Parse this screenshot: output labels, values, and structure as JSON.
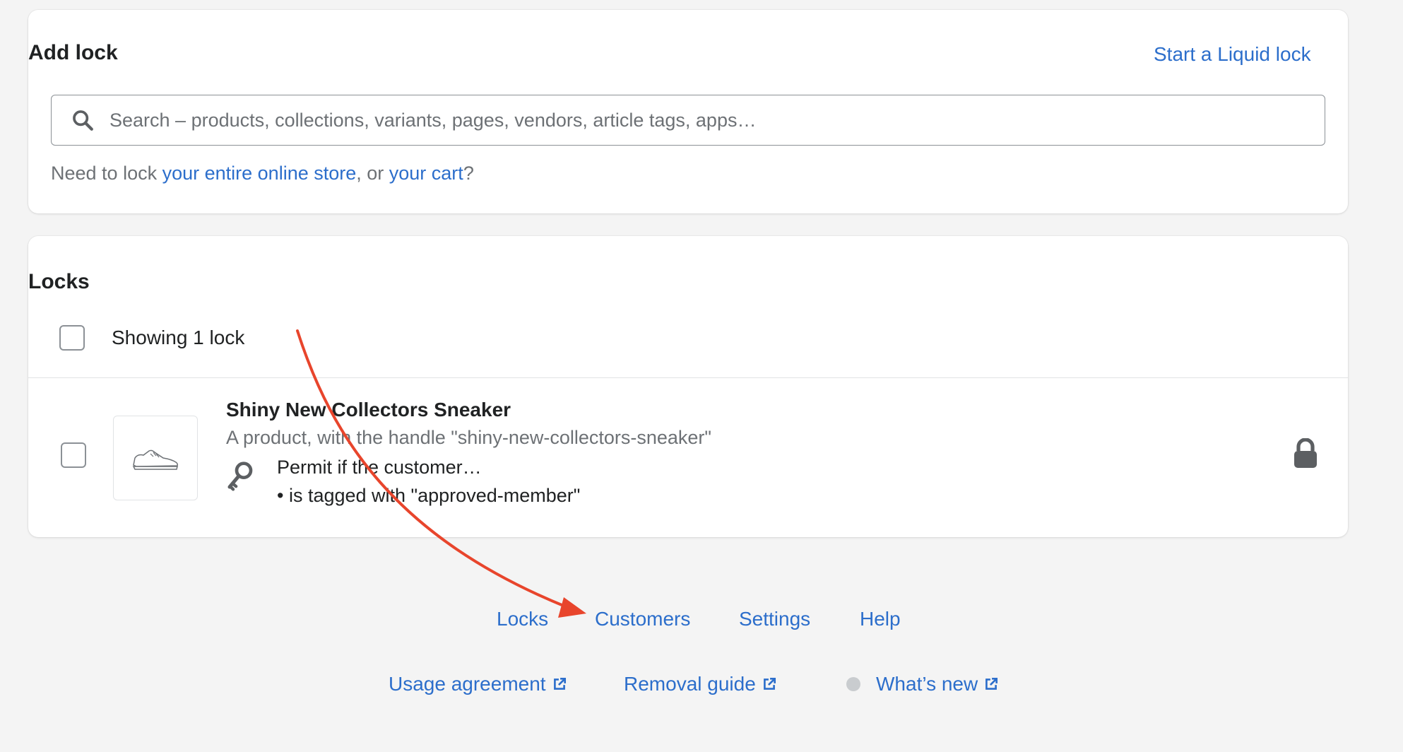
{
  "colors": {
    "link": "#2c6ecb",
    "text": "#202223",
    "subdued": "#6d7175",
    "background": "#f4f4f4",
    "annotation_arrow": "#e8452c"
  },
  "add_lock": {
    "title": "Add lock",
    "liquid_link": "Start a Liquid lock",
    "search_icon": "search-icon",
    "search_placeholder": "Search – products, collections, variants, pages, vendors, article tags, apps…",
    "search_value": "",
    "need_prefix": "Need to lock ",
    "need_link_store": "your entire online store",
    "need_mid": ", or ",
    "need_link_cart": "your cart",
    "need_suffix": "?"
  },
  "locks": {
    "title": "Locks",
    "showing": "Showing 1 lock",
    "items": [
      {
        "name": "Shiny New Collectors Sneaker",
        "description": "A product, with the handle \"shiny-new-collectors-sneaker\"",
        "thumbnail_icon": "sneaker-icon",
        "key_icon": "key-icon",
        "permit": "Permit if the customer…",
        "condition": "• is tagged with \"approved-member\"",
        "status_icon": "lock-icon"
      }
    ]
  },
  "footer": {
    "nav": [
      "Locks",
      "Customers",
      "Settings",
      "Help"
    ],
    "links": [
      "Usage agreement",
      "Removal guide",
      "What’s new"
    ],
    "external_icon": "external-link-icon"
  }
}
